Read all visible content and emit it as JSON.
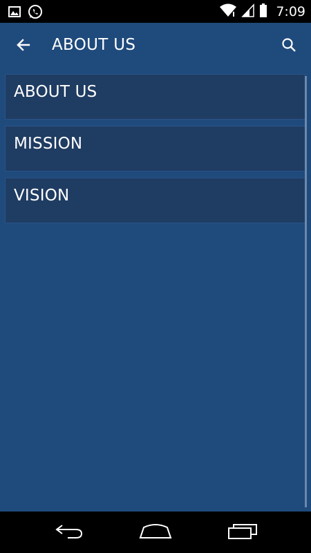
{
  "status_bar": {
    "time": "7:09",
    "icons": [
      "image-notification-icon",
      "whatsapp-icon",
      "wifi-icon",
      "signal-icon",
      "battery-icon"
    ]
  },
  "app_bar": {
    "title": "ABOUT US",
    "back_icon": "arrow-left-icon",
    "search_icon": "search-icon"
  },
  "menu": {
    "items": [
      {
        "label": "ABOUT US"
      },
      {
        "label": "MISSION"
      },
      {
        "label": "VISION"
      }
    ]
  },
  "nav_bar": {
    "icons": [
      "back-nav-icon",
      "home-nav-icon",
      "recents-nav-icon"
    ]
  },
  "colors": {
    "background": "#1f4a7c",
    "menu_item": "#1f3c62",
    "text": "#ffffff"
  }
}
